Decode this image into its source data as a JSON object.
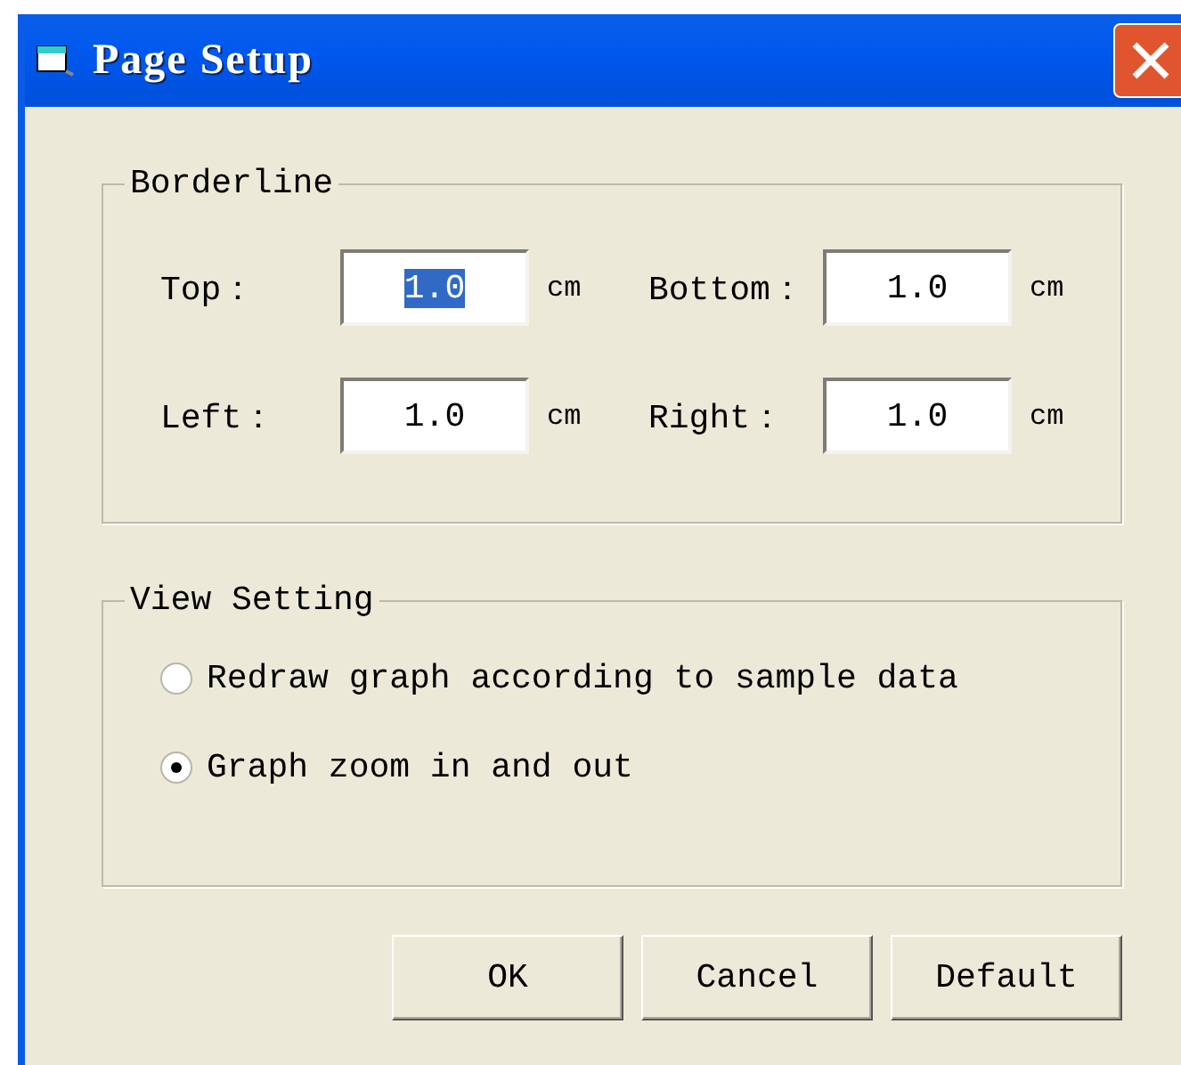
{
  "window": {
    "title": "Page Setup"
  },
  "borderline": {
    "legend": "Borderline",
    "fields": [
      {
        "label": "Top：",
        "value": "1.0",
        "unit": "cm",
        "text_selected": true
      },
      {
        "label": "Bottom：",
        "value": "1.0",
        "unit": "cm",
        "text_selected": false
      },
      {
        "label": "Left：",
        "value": "1.0",
        "unit": "cm",
        "text_selected": false
      },
      {
        "label": "Right：",
        "value": "1.0",
        "unit": "cm",
        "text_selected": false
      }
    ]
  },
  "view_setting": {
    "legend": "View Setting",
    "options": [
      {
        "label": "Redraw graph according to sample data",
        "selected": false
      },
      {
        "label": "Graph zoom in and out",
        "selected": true
      }
    ]
  },
  "buttons": [
    "OK",
    "Cancel",
    "Default"
  ]
}
